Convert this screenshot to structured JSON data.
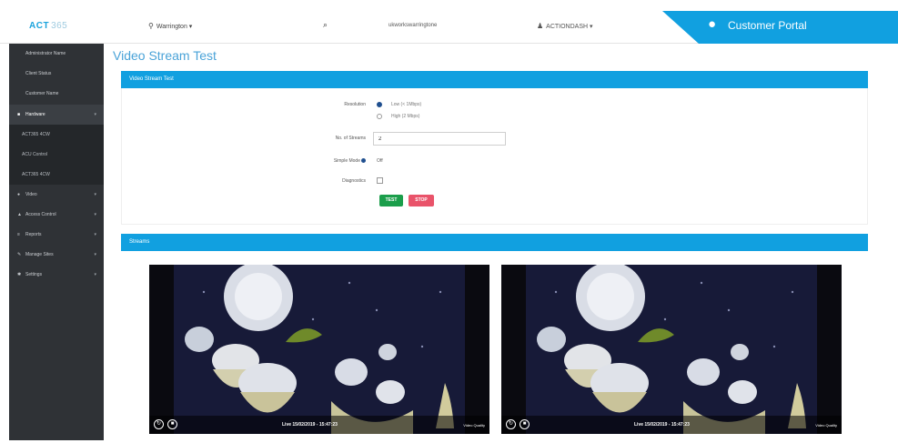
{
  "header": {
    "logo": "ACT",
    "logo_sub": "365",
    "site": "Warrington",
    "site_arrow": "▾",
    "host": "ukworkswarringtone",
    "user": "ACTIONDASH",
    "user_arrow": "▾",
    "portal": "Customer Portal"
  },
  "sidebar": {
    "items": [
      {
        "label": "Administrator Name",
        "icon": "",
        "chevron": ""
      },
      {
        "label": "Client Status",
        "icon": "",
        "chevron": ""
      },
      {
        "label": "Customer Name",
        "icon": "",
        "chevron": ""
      },
      {
        "label": "Hardware",
        "icon": "■",
        "chevron": "▾"
      },
      {
        "label": "ACT365 4CW",
        "icon": "",
        "chevron": ""
      },
      {
        "label": "ACU Control",
        "icon": "",
        "chevron": ""
      },
      {
        "label": "ACT365 4CW",
        "icon": "",
        "chevron": ""
      },
      {
        "label": "Video",
        "icon": "●",
        "chevron": "▾"
      },
      {
        "label": "Access Control",
        "icon": "▲",
        "chevron": "▾"
      },
      {
        "label": "Reports",
        "icon": "≡",
        "chevron": "▾"
      },
      {
        "label": "Manage Sites",
        "icon": "✎",
        "chevron": "▾"
      },
      {
        "label": "Settings",
        "icon": "✱",
        "chevron": "▾"
      }
    ]
  },
  "page": {
    "title": "Video Stream Test"
  },
  "test_panel": {
    "title": "Video Stream Test",
    "resolution_label": "Resolution",
    "resolution_options": [
      "Low (< 1Mbps)",
      "High (2 Mbps)"
    ],
    "resolution_selected": "Low (< 1Mbps)",
    "streams_label": "No. of Streams",
    "streams_value": "2",
    "simple_mode_label": "Simple Mode",
    "simple_mode_value": "Off",
    "diagnostics_label": "Diagnostics",
    "test_button": "TEST",
    "stop_button": "STOP"
  },
  "streams_panel": {
    "title": "Streams",
    "videos": [
      {
        "timestamp": "Live 15/02/2019 - 15:47:23",
        "badge": "Video Quality"
      },
      {
        "timestamp": "Live 15/02/2019 - 15:47:23",
        "badge": "Video Quality"
      }
    ]
  },
  "colors": {
    "accent": "#11a0e0",
    "sidebar": "#2f3236",
    "test_button": "#1b9e4b",
    "stop_button": "#e9536a"
  }
}
